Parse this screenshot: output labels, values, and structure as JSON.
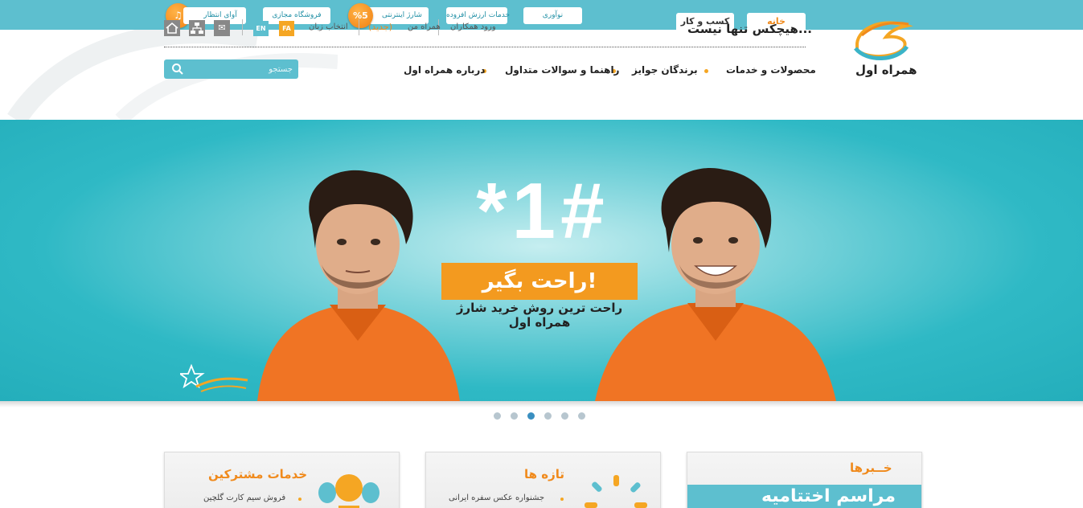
{
  "colors": {
    "teal": "#5dbfcf",
    "orange": "#f08a1c",
    "banner": "#2bb8c4",
    "dot_active": "#3a8fc0"
  },
  "top_strip": {
    "wait_music": "آوای انتظار",
    "virtual_store": "فروشگاه مجازی",
    "internet_charge": "شارژ اینترنتی",
    "percent_badge": "%5",
    "vas": "خدمات ارزش افزوده",
    "innovation": "نوآوری",
    "tab_business": "کسب و کار",
    "tab_home": "خانه"
  },
  "header": {
    "slogan": "هیچکس تنها نیست...",
    "logo_text": "همراه اول",
    "partners_login": "ورود همکاران",
    "my_hamrah": "همراه من",
    "new_tag": "(جدید)",
    "lang_select": "انتخاب زبان",
    "lang_fa": "FA",
    "lang_en": "EN",
    "icons": [
      "home-icon",
      "sitemap-icon",
      "mail-icon"
    ],
    "search_placeholder": "جستجو"
  },
  "nav": {
    "items": [
      "محصولات و خدمات",
      "برندگان جوایز",
      "راهنما و سوالات متداول",
      "درباره همراه اول"
    ]
  },
  "banner": {
    "big_code": "*1#",
    "headline": "راحت بگیر!",
    "subline": "راحت ترین روش خرید شارژ همراه اول",
    "stamp": "ستاره اول",
    "active_slide": 3,
    "slides": 6
  },
  "cards": {
    "services": {
      "title": "خدمات مشترکین",
      "line1": "فروش سیم کارت گلچین",
      "line2": ""
    },
    "fresh": {
      "title": "تازه ها",
      "line1": "جشنواره عکس سفره ایرانی",
      "line2": ""
    },
    "news": {
      "title": "خــبرها",
      "strip_text": "مراسم اختتامیه"
    }
  }
}
